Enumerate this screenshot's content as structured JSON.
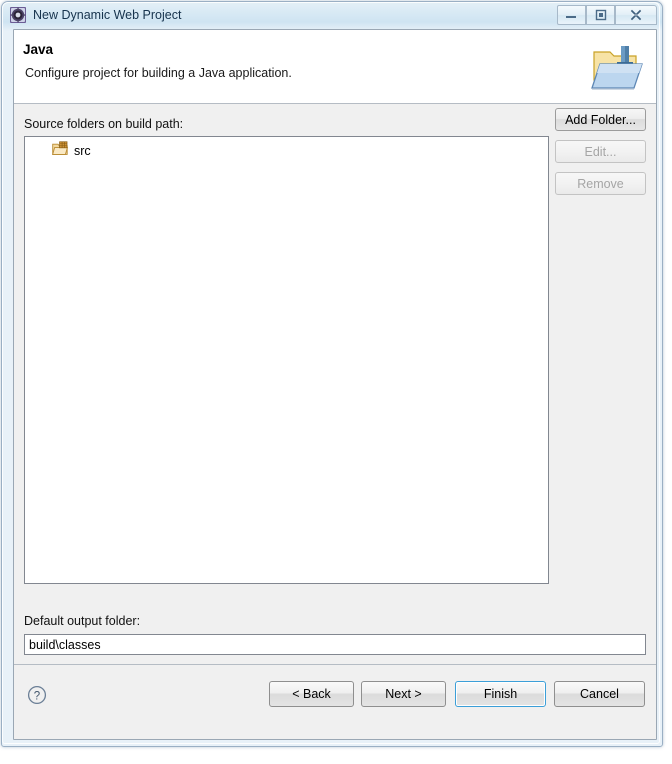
{
  "window": {
    "title": "New Dynamic Web Project",
    "icon": "eclipse-wizard-icon",
    "controls": {
      "minimize": "minimize-icon",
      "maximize": "maximize-icon",
      "close": "close-icon"
    }
  },
  "header": {
    "title": "Java",
    "description": "Configure project for building a Java application.",
    "icon": "java-folder-banner-icon"
  },
  "content": {
    "source_label": "Source folders on build path:",
    "source_folders": [
      {
        "label": "src",
        "icon": "source-folder-icon"
      }
    ],
    "output_label": "Default output folder:",
    "output_value": "build\\classes",
    "side_buttons": [
      {
        "label": "Add Folder...",
        "enabled": true
      },
      {
        "label": "Edit...",
        "enabled": false
      },
      {
        "label": "Remove",
        "enabled": false
      }
    ]
  },
  "footer": {
    "help": "help-icon",
    "back": "< Back",
    "next": "Next >",
    "finish": "Finish",
    "cancel": "Cancel"
  },
  "colors": {
    "accent": "#3c9fd8",
    "titlebar": "#cfe4f2",
    "dialog_bg": "#f0f0f0",
    "field_bg": "#ffffff"
  }
}
